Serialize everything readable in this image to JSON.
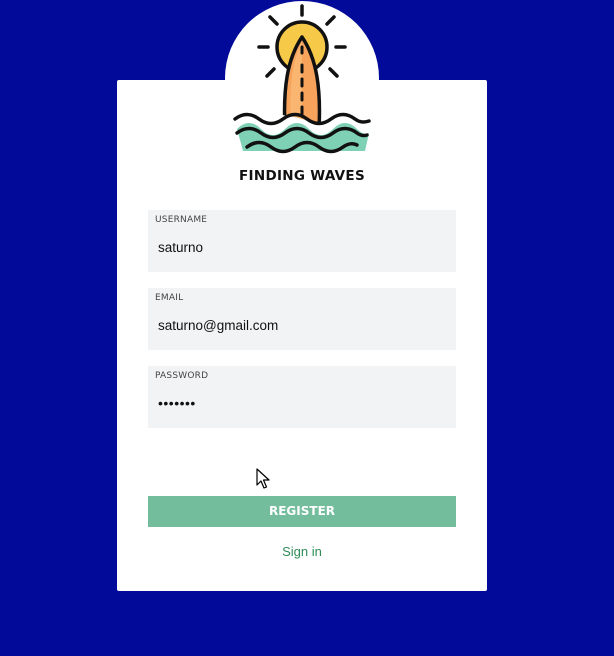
{
  "app": {
    "title": "FINDING WAVES",
    "logo_icon": "sun-surfboard-waves-logo"
  },
  "form": {
    "username": {
      "label": "USERNAME",
      "value": "saturno"
    },
    "email": {
      "label": "EMAIL",
      "value": "saturno@gmail.com"
    },
    "password": {
      "label": "PASSWORD",
      "value": "•••••••"
    },
    "register_label": "REGISTER",
    "signin_label": "Sign in"
  },
  "colors": {
    "background": "#020b99",
    "card": "#ffffff",
    "field_bg": "#f2f3f5",
    "button": "#74bd9c",
    "link": "#2e8b57"
  }
}
